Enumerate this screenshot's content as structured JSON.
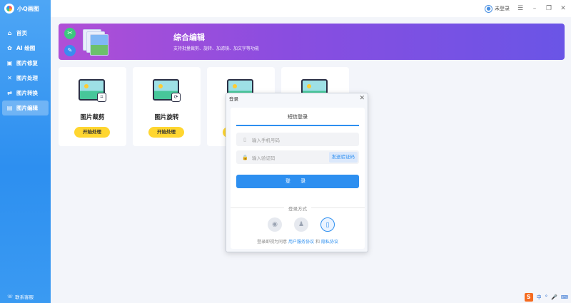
{
  "app": {
    "title": "小Q画图"
  },
  "sidebar": {
    "items": [
      {
        "label": "首页",
        "icon": "home-icon",
        "glyph": "⌂"
      },
      {
        "label": "AI 绘图",
        "icon": "palette-icon",
        "glyph": "✿"
      },
      {
        "label": "图片修复",
        "icon": "repair-icon",
        "glyph": "▣"
      },
      {
        "label": "图片处理",
        "icon": "tools-icon",
        "glyph": "✕"
      },
      {
        "label": "图片转换",
        "icon": "convert-icon",
        "glyph": "⇄"
      },
      {
        "label": "图片编辑",
        "icon": "edit-icon",
        "glyph": "▤"
      }
    ],
    "active_index": 5,
    "support": "联系客服"
  },
  "topbar": {
    "user": "未登录"
  },
  "banner": {
    "title": "综合编辑",
    "subtitle": "支持批量裁剪、旋转、加滤镜、加文字等功能"
  },
  "cards": [
    {
      "name": "图片裁剪",
      "button": "开始处理"
    },
    {
      "name": "图片旋转",
      "button": "开始处理"
    },
    {
      "name": "",
      "button": ""
    },
    {
      "name": "",
      "button": ""
    }
  ],
  "dialog": {
    "title": "登录",
    "tab": "短信登录",
    "phone_placeholder": "输入手机号码",
    "code_placeholder": "输入验证码",
    "send_code": "发送验证码",
    "login": "登 录",
    "other": "登录方式",
    "agree_prefix": "登录即视为同意",
    "agree_terms": "用户服务协议",
    "agree_and": "和",
    "agree_privacy": "隐私协议"
  },
  "tray": {
    "ime": "S",
    "items": [
      "中",
      "°",
      "🎤",
      "⌨"
    ]
  },
  "colors": {
    "accent": "#2d8ff0",
    "button_yellow": "#ffd630",
    "banner_start": "#b04fd6",
    "banner_end": "#6a55e6"
  }
}
